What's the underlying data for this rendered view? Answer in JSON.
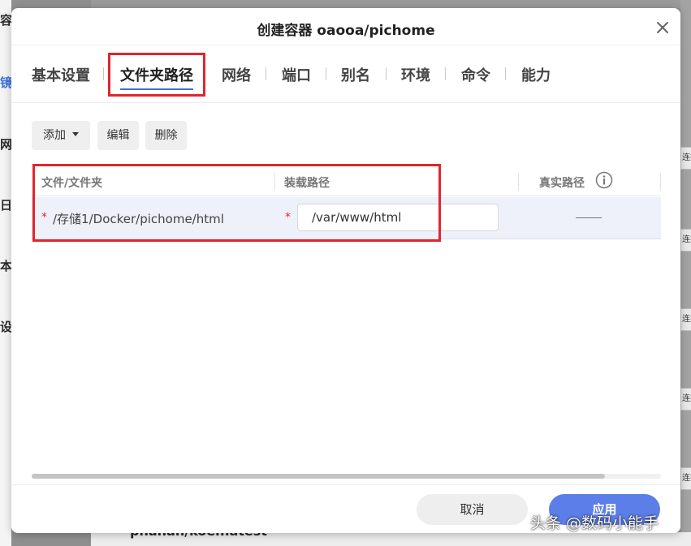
{
  "background": {
    "left_fragments": [
      "容器",
      "镜",
      "网",
      "日",
      "本",
      "设"
    ],
    "right_tag": "连接",
    "bottom_text": "phanan/koel:latest"
  },
  "dialog": {
    "title": "创建容器 oaooa/pichome",
    "tabs": [
      {
        "label": "基本设置",
        "active": false
      },
      {
        "label": "文件夹路径",
        "active": true
      },
      {
        "label": "网络",
        "active": false
      },
      {
        "label": "端口",
        "active": false
      },
      {
        "label": "别名",
        "active": false
      },
      {
        "label": "环境",
        "active": false
      },
      {
        "label": "命令",
        "active": false
      },
      {
        "label": "能力",
        "active": false
      }
    ],
    "toolbar": {
      "add_label": "添加",
      "edit_label": "编辑",
      "delete_label": "删除"
    },
    "grid": {
      "columns": [
        "文件/文件夹",
        "装载路径",
        "真实路径"
      ],
      "rows": [
        {
          "required_mark": "*",
          "file": "/存储1/Docker/pichome/html",
          "mount_path": "/var/www/html",
          "real_path": ""
        }
      ]
    },
    "footer": {
      "cancel_label": "取消",
      "apply_label": "应用"
    }
  },
  "watermark": "头条 @数码小能手",
  "colors": {
    "accent": "#3c6fd8",
    "highlight": "#e0262f",
    "apply_button": "#5c7ee8",
    "row_selected": "#eef0fa"
  }
}
